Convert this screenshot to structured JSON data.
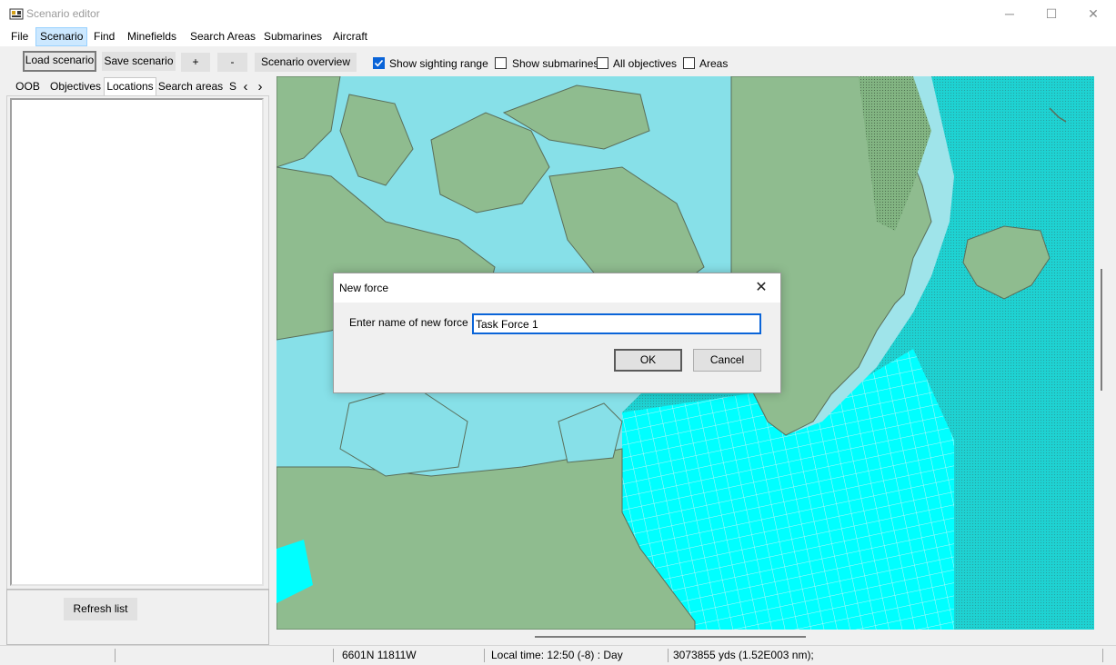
{
  "window": {
    "title": "Scenario editor",
    "minimize": "─",
    "maximize": "☐",
    "close": "✕"
  },
  "menu": [
    "File",
    "Scenario",
    "Find",
    "Minefields",
    "Search Areas",
    "Submarines",
    "Aircraft"
  ],
  "menu_active": "Scenario",
  "toolbar": {
    "load_scenario": "Load scenario",
    "save_scenario": "Save scenario",
    "zoom_in": "+",
    "zoom_out": "-",
    "scenario_overview": "Scenario overview",
    "show_sighting_range": {
      "label": "Show sighting range",
      "checked": true
    },
    "show_submarines": {
      "label": "Show submarines",
      "checked": false
    },
    "all_objectives": {
      "label": "All objectives",
      "checked": false
    },
    "areas": {
      "label": "Areas",
      "checked": false
    }
  },
  "tabs": [
    "OOB",
    "Objectives",
    "Locations",
    "Search areas",
    "S"
  ],
  "tab_selected": "Locations",
  "tab_scroll": {
    "left": "‹",
    "right": "›"
  },
  "left_panel": {
    "refresh_button": "Refresh list"
  },
  "dialog": {
    "title": "New force",
    "close": "✕",
    "prompt": "Enter name of new force",
    "input_value": "Task Force 1",
    "ok": "OK",
    "cancel": "Cancel"
  },
  "status": {
    "coords": "6601N 11811W",
    "local_time": "Local time: 12:50 (-8) : Day",
    "distance": "3073855 yds (1.52E003 nm);"
  },
  "colors": {
    "land": "#8fbc8f",
    "shallow_water": "#87e0e8",
    "deep_water": "#00e5e5",
    "grid_water": "#00ffff",
    "selection_blue": "#0a64d8"
  }
}
